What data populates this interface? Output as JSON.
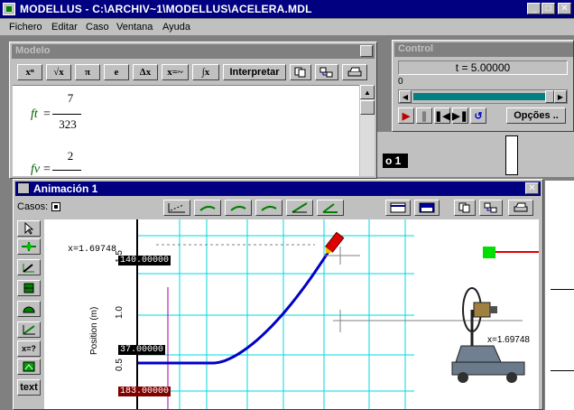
{
  "app": {
    "title": "MODELLUS - C:\\ARCHIV~1\\MODELLUS\\ACELERA.MDL"
  },
  "menu": [
    "Fichero",
    "Editar",
    "Caso",
    "Ventana",
    "Ayuda"
  ],
  "modelo": {
    "title": "Modelo",
    "toolbar": [
      "xⁿ",
      "√x",
      "π",
      "e",
      "Δx",
      "x=~",
      "∫x",
      "Interpretar"
    ],
    "eq1": {
      "lhs": "ft",
      "num": "7",
      "den": "323"
    },
    "eq2": {
      "lhs": "fv",
      "num": "2",
      "den": ""
    }
  },
  "control": {
    "title": "Control",
    "time_label": "t =  5.00000",
    "slider_min": "0",
    "progress": 1.0,
    "options_label": "Opções .."
  },
  "back_label": "o 1",
  "animacion": {
    "title": "Animación 1",
    "casos_label": "Casos:",
    "tools": [
      "",
      "",
      "",
      "",
      "",
      "",
      "x=?",
      "",
      "text"
    ],
    "x_readout_top": "x=1.69748",
    "ylabel": "Position (m)",
    "ticks": [
      "1.5",
      "1.0",
      "0.5"
    ],
    "box_top": "140.00000",
    "box_mid": "37.00000",
    "box_bottom": "183.00000",
    "cart_label": "x=1.69748"
  },
  "colors": {
    "titlebar": "#000080",
    "grid": "#00e0e0",
    "curve": "#0000c8",
    "pen": "#e00000",
    "marker": "#00e000"
  }
}
